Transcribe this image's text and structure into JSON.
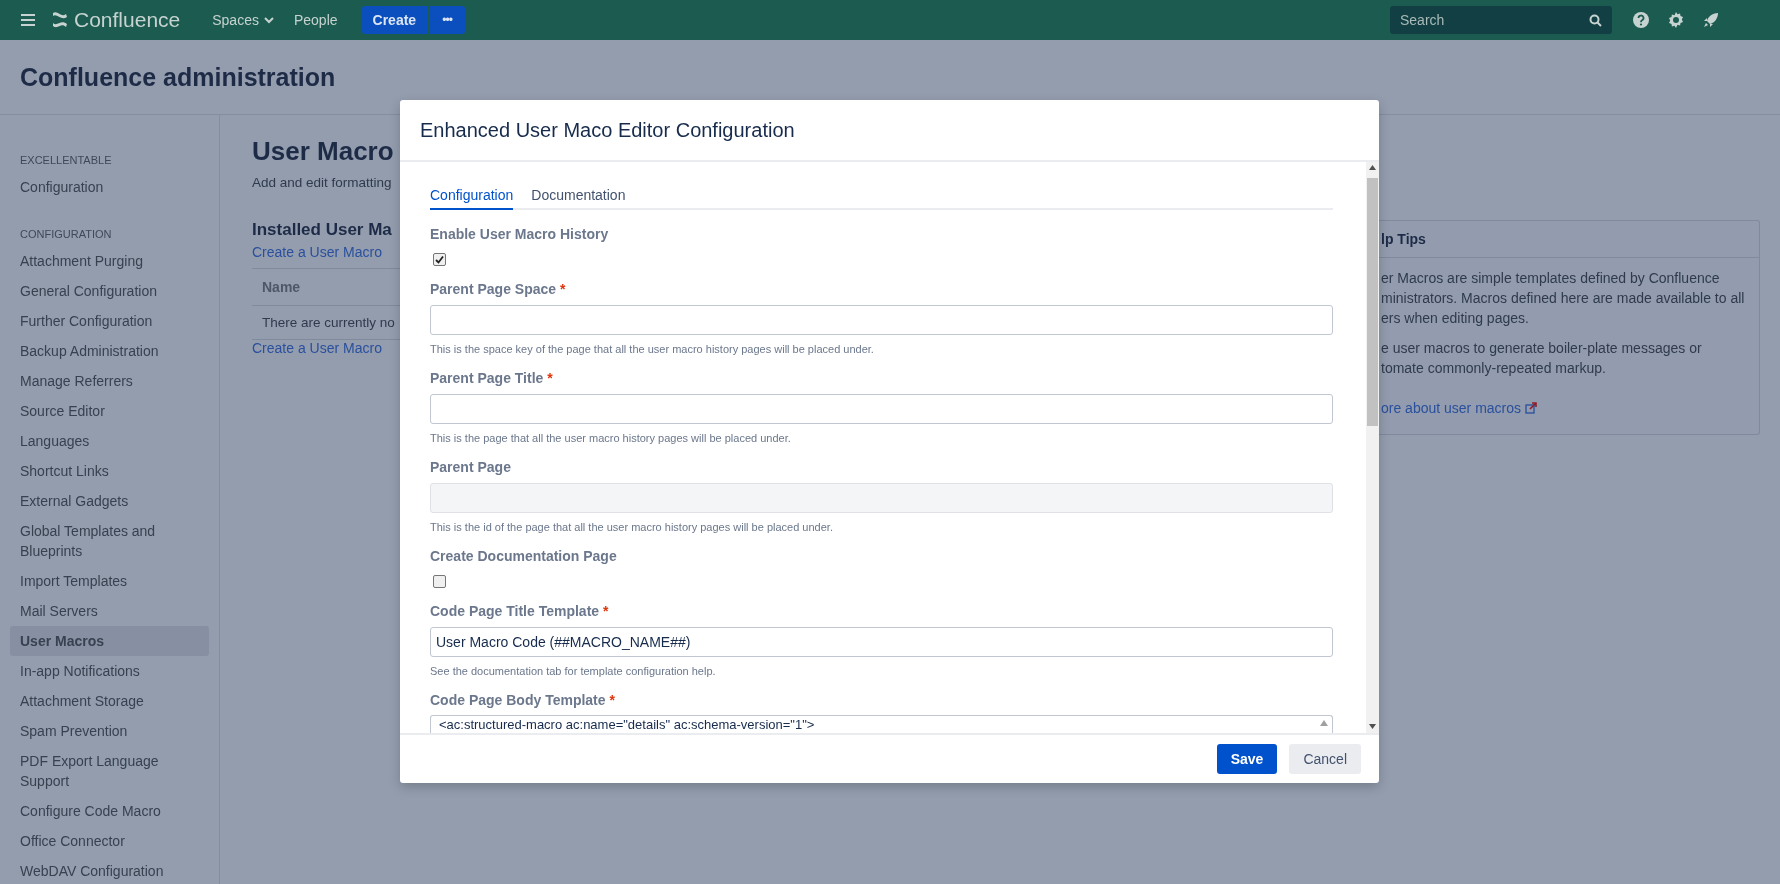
{
  "topbar": {
    "logo": "Confluence",
    "nav": [
      {
        "label": "Spaces",
        "kind": "dropdown"
      },
      {
        "label": "People",
        "kind": "link"
      }
    ],
    "create": "Create",
    "more": "•••",
    "search": {
      "placeholder": "Search"
    }
  },
  "header": {
    "title": "Confluence administration"
  },
  "sidebar": {
    "sections": [
      {
        "heading": "EXCELLENTABLE",
        "items": [
          {
            "label": "Configuration",
            "selected": false
          }
        ]
      },
      {
        "heading": "CONFIGURATION",
        "items": [
          {
            "label": "Attachment Purging",
            "selected": false
          },
          {
            "label": "General Configuration",
            "selected": false
          },
          {
            "label": "Further Configuration",
            "selected": false
          },
          {
            "label": "Backup Administration",
            "selected": false
          },
          {
            "label": "Manage Referrers",
            "selected": false
          },
          {
            "label": "Source Editor",
            "selected": false
          },
          {
            "label": "Languages",
            "selected": false
          },
          {
            "label": "Shortcut Links",
            "selected": false
          },
          {
            "label": "External Gadgets",
            "selected": false
          },
          {
            "label": "Global Templates and Blueprints",
            "selected": false
          },
          {
            "label": "Import Templates",
            "selected": false
          },
          {
            "label": "Mail Servers",
            "selected": false
          },
          {
            "label": "User Macros",
            "selected": true
          },
          {
            "label": "In-app Notifications",
            "selected": false
          },
          {
            "label": "Attachment Storage",
            "selected": false
          },
          {
            "label": "Spam Prevention",
            "selected": false
          },
          {
            "label": "PDF Export Language Support",
            "selected": false
          },
          {
            "label": "Configure Code Macro",
            "selected": false
          },
          {
            "label": "Office Connector",
            "selected": false
          },
          {
            "label": "WebDAV Configuration",
            "selected": false
          }
        ]
      }
    ]
  },
  "main": {
    "title": "User Macro",
    "description": "Add and edit formatting",
    "section_title": "Installed User Ma",
    "create_link": "Create a User Macro",
    "table": {
      "columns": [
        "Name"
      ],
      "rows": [
        [
          "There are currently no"
        ]
      ]
    },
    "create_link_bottom": "Create a User Macro"
  },
  "help_tips": {
    "title": "lp Tips",
    "paragraphs": [
      [
        "er Macros are simple templates defined by Confluence",
        "ministrators. Macros defined here are made available to all",
        "ers when editing pages."
      ],
      [
        "e user macros to generate boiler-plate messages or",
        "tomate commonly-repeated markup."
      ]
    ],
    "link": "ore about user macros"
  },
  "dialog": {
    "title": "Enhanced User Maco Editor Configuration",
    "tabs": [
      {
        "label": "Configuration",
        "selected": true
      },
      {
        "label": "Documentation",
        "selected": false
      }
    ],
    "fields": [
      {
        "kind": "checkbox",
        "label": "Enable User Macro History",
        "checked": true
      },
      {
        "kind": "text",
        "label": "Parent Page Space",
        "marker": "*",
        "disabled": false,
        "help": "This is the space key of the page that all the user macro history pages will be placed under."
      },
      {
        "kind": "text",
        "label": "Parent Page Title",
        "marker": "*",
        "disabled": false,
        "help": "This is the page that all the user macro history pages will be placed under."
      },
      {
        "kind": "text",
        "label": "Parent Page",
        "disabled": true,
        "help": "This is the id of the page that all the user macro history pages will be placed under."
      },
      {
        "kind": "checkbox",
        "label": "Create Documentation Page",
        "checked": false
      },
      {
        "kind": "text",
        "label": "Code Page Title Template",
        "marker": "*",
        "disabled": false,
        "value": "User Macro Code (##MACRO_NAME##)",
        "help": "See the documentation tab for template configuration help."
      },
      {
        "kind": "textarea",
        "label": "Code Page Body Template",
        "marker": "*",
        "value": "<ac:structured-macro ac:name=\"details\" ac:schema-version=\"1\">"
      }
    ],
    "buttons": [
      {
        "label": "Save",
        "kind": "primary"
      },
      {
        "label": "Cancel",
        "kind": "secondary"
      }
    ]
  }
}
